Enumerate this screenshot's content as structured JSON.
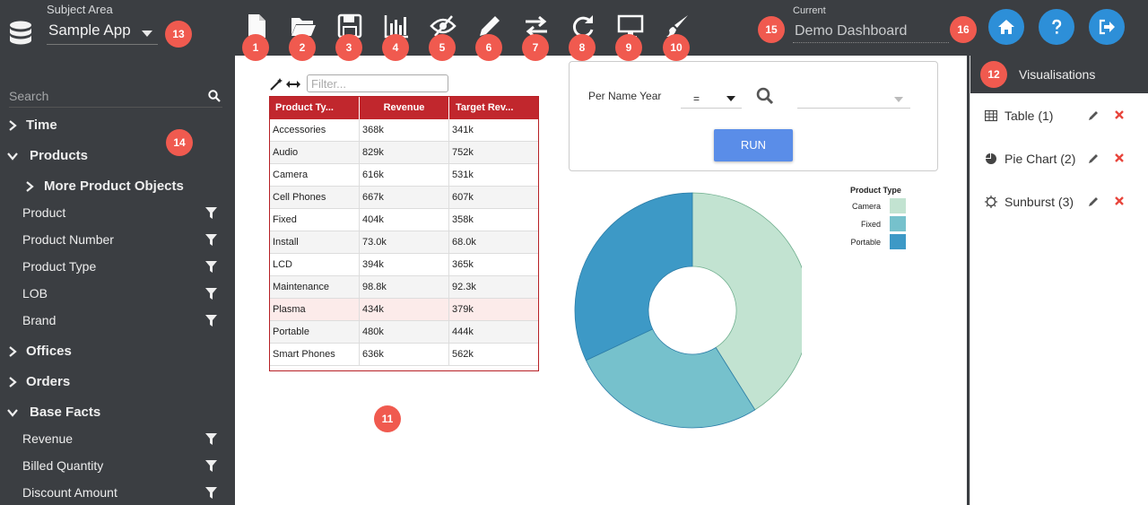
{
  "header": {
    "subject_area_label": "Subject Area",
    "subject_area_value": "Sample App",
    "current_label": "Current",
    "current_dashboard": "Demo Dashboard",
    "toolbar_icons": [
      "new-file-icon",
      "open-folder-icon",
      "save-icon",
      "bar-chart-icon",
      "hide-eye-icon",
      "pencil-icon",
      "swap-arrows-icon",
      "refresh-icon",
      "monitor-icon",
      "paint-brush-icon"
    ],
    "right_buttons": [
      "home-icon",
      "help-icon",
      "logout-icon"
    ]
  },
  "badges": {
    "b1": "1",
    "b2": "2",
    "b3": "3",
    "b4": "4",
    "b5": "5",
    "b6": "6",
    "b7": "7",
    "b8": "8",
    "b9": "9",
    "b10": "10",
    "b11": "11",
    "b12": "12",
    "b13": "13",
    "b14": "14",
    "b15": "15",
    "b16": "16"
  },
  "sidebar": {
    "search_placeholder": "Search",
    "items": [
      {
        "label": "Time",
        "type": "group",
        "state": "collapsed"
      },
      {
        "label": "Products",
        "type": "group",
        "state": "expanded"
      },
      {
        "label": "More Product Objects",
        "type": "subgroup",
        "state": "collapsed"
      },
      {
        "label": "Product",
        "type": "leaf"
      },
      {
        "label": "Product Number",
        "type": "leaf"
      },
      {
        "label": "Product Type",
        "type": "leaf"
      },
      {
        "label": "LOB",
        "type": "leaf"
      },
      {
        "label": "Brand",
        "type": "leaf"
      },
      {
        "label": "Offices",
        "type": "group",
        "state": "collapsed"
      },
      {
        "label": "Orders",
        "type": "group",
        "state": "collapsed"
      },
      {
        "label": "Base Facts",
        "type": "group",
        "state": "expanded"
      },
      {
        "label": "Revenue",
        "type": "leaf"
      },
      {
        "label": "Billed Quantity",
        "type": "leaf"
      },
      {
        "label": "Discount Amount",
        "type": "leaf"
      }
    ]
  },
  "table": {
    "filter_placeholder": "Filter...",
    "columns": [
      "Product Ty...",
      "Revenue",
      "Target Rev..."
    ],
    "rows": [
      [
        "Accessories",
        "368k",
        "341k"
      ],
      [
        "Audio",
        "829k",
        "752k"
      ],
      [
        "Camera",
        "616k",
        "531k"
      ],
      [
        "Cell Phones",
        "667k",
        "607k"
      ],
      [
        "Fixed",
        "404k",
        "358k"
      ],
      [
        "Install",
        "73.0k",
        "68.0k"
      ],
      [
        "LCD",
        "394k",
        "365k"
      ],
      [
        "Maintenance",
        "98.8k",
        "92.3k"
      ],
      [
        "Plasma",
        "434k",
        "379k"
      ],
      [
        "Portable",
        "480k",
        "444k"
      ],
      [
        "Smart Phones",
        "636k",
        "562k"
      ]
    ]
  },
  "prompt": {
    "label": "Per Name Year",
    "operator": "=",
    "value": "",
    "run_label": "RUN"
  },
  "chart_data": {
    "type": "pie",
    "legend_title": "Product Type",
    "categories": [
      "Camera",
      "Fixed",
      "Portable"
    ],
    "values": [
      616,
      404,
      480
    ],
    "colors": [
      "#c2e3d1",
      "#76c1cc",
      "#3d99c6"
    ],
    "donut": true,
    "legend_position": "top-right"
  },
  "visualisations": {
    "header": "Visualisations",
    "items": [
      {
        "label": "Table (1)",
        "icon": "table-icon"
      },
      {
        "label": "Pie Chart (2)",
        "icon": "pie-chart-icon"
      },
      {
        "label": "Sunburst (3)",
        "icon": "sunburst-icon"
      }
    ]
  }
}
